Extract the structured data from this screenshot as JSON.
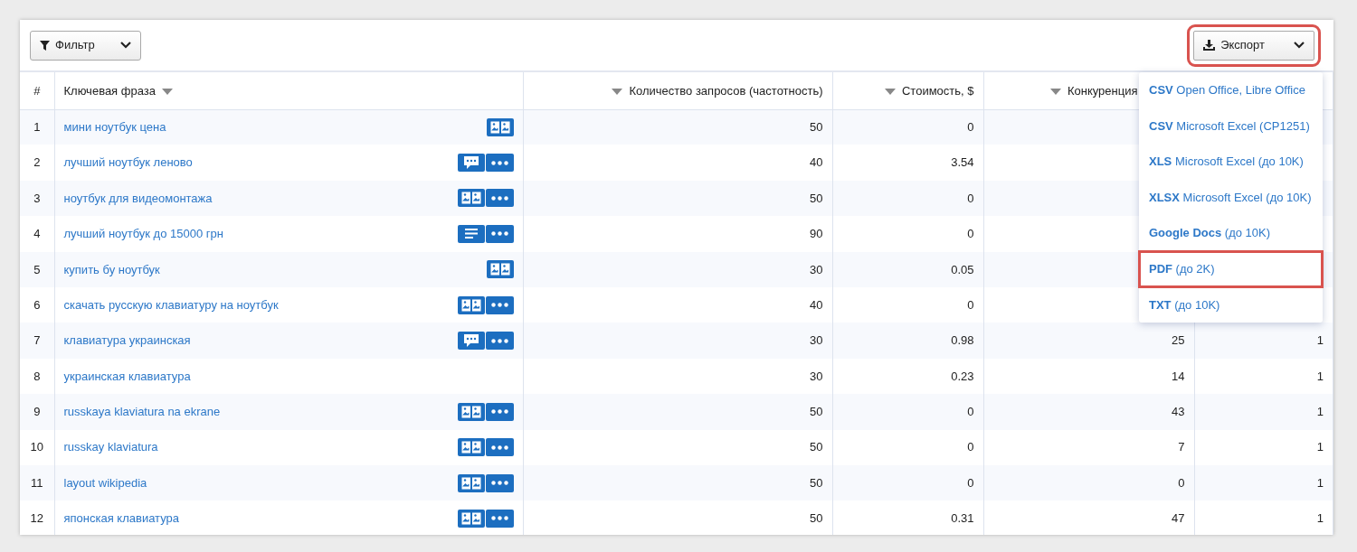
{
  "toolbar": {
    "filter_button": {
      "label": "Фильтр"
    },
    "export_button": {
      "label": "Экспорт",
      "highlighted": true
    }
  },
  "table": {
    "columns": [
      {
        "label": "#",
        "sort": false
      },
      {
        "label": "Ключевая фраза",
        "sort": true
      },
      {
        "label": "Количество запросов (частотность)",
        "sort": true
      },
      {
        "label": "Стоимость, $",
        "sort": true
      },
      {
        "label": "Конкуренция",
        "sort": true
      }
    ],
    "rows": [
      {
        "num": "1",
        "phrase": "мини ноутбук цена",
        "kind": "images",
        "more": false,
        "frequency": "50",
        "cost": "0"
      },
      {
        "num": "2",
        "phrase": "лучший ноутбук леново",
        "kind": "comment",
        "more": true,
        "frequency": "40",
        "cost": "3.54"
      },
      {
        "num": "3",
        "phrase": "ноутбук для видеомонтажа",
        "kind": "images",
        "more": true,
        "frequency": "50",
        "cost": "0"
      },
      {
        "num": "4",
        "phrase": "лучший ноутбук до 15000 грн",
        "kind": "text",
        "more": true,
        "frequency": "90",
        "cost": "0"
      },
      {
        "num": "5",
        "phrase": "купить бу ноутбук",
        "kind": "images",
        "more": false,
        "frequency": "30",
        "cost": "0.05"
      },
      {
        "num": "6",
        "phrase": "скачать русскую клавиатуру на ноутбук",
        "kind": "images",
        "more": true,
        "frequency": "40",
        "cost": "0"
      },
      {
        "num": "7",
        "phrase": "клавиатура украинская",
        "kind": "comment",
        "more": true,
        "frequency": "30",
        "cost": "0.98",
        "competition": "25",
        "column_6": "1"
      },
      {
        "num": "8",
        "phrase": "украинская клавиатура",
        "kind": "plain",
        "more": false,
        "frequency": "30",
        "cost": "0.23",
        "competition": "14",
        "column_6": "1"
      },
      {
        "num": "9",
        "phrase": "russkaya klaviatura na ekrane",
        "kind": "images",
        "more": true,
        "frequency": "50",
        "cost": "0",
        "competition": "43",
        "column_6": "1"
      },
      {
        "num": "10",
        "phrase": "russkay klaviatura",
        "kind": "images",
        "more": true,
        "frequency": "50",
        "cost": "0",
        "competition": "7",
        "column_6": "1"
      },
      {
        "num": "11",
        "phrase": "layout wikipedia",
        "kind": "images",
        "more": true,
        "frequency": "50",
        "cost": "0",
        "competition": "0",
        "column_6": "1"
      },
      {
        "num": "12",
        "phrase": "японская клавиатура",
        "kind": "images",
        "more": true,
        "frequency": "50",
        "cost": "0.31",
        "competition": "47",
        "column_6": "1"
      }
    ]
  },
  "export_menu": {
    "items": [
      {
        "format": "CSV",
        "label": "Open Office, Libre Office",
        "highlighted": false
      },
      {
        "format": "CSV",
        "label": "Microsoft Excel (CP1251)",
        "highlighted": false
      },
      {
        "format": "XLS",
        "label": "Microsoft Excel (до 10K)",
        "highlighted": false
      },
      {
        "format": "XLSX",
        "label": "Microsoft Excel (до 10K)",
        "highlighted": false
      },
      {
        "format": "Google Docs",
        "label": "(до 10K)",
        "highlighted": false
      },
      {
        "format": "PDF",
        "label": "(до 2K)",
        "highlighted": true
      },
      {
        "format": "TXT",
        "label": "(до 10K)",
        "highlighted": false
      }
    ]
  }
}
